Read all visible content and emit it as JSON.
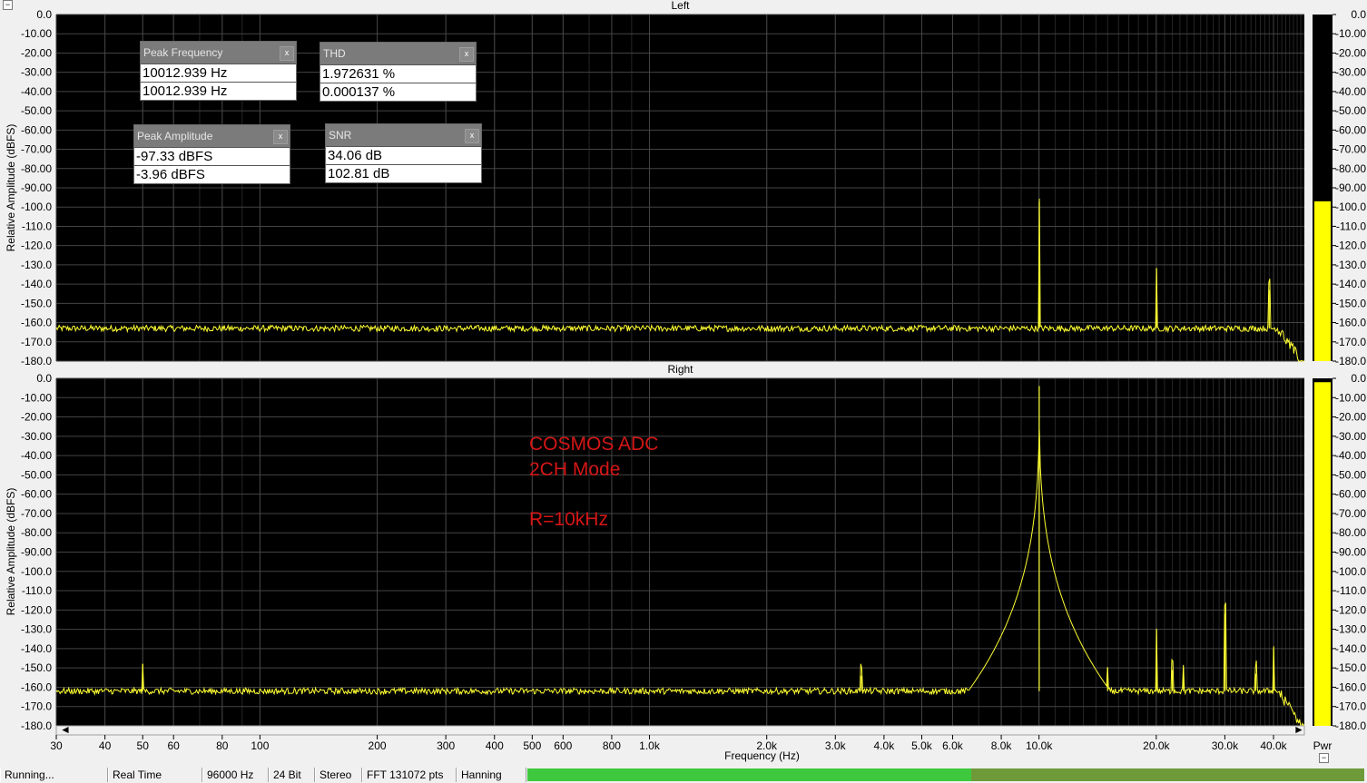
{
  "window": {
    "collapse_top": "−",
    "collapse_bottom": "−"
  },
  "overlay_text": {
    "line1": "COSMOS ADC",
    "line2": "2CH Mode",
    "line3": "R=10kHz"
  },
  "readouts": [
    {
      "title": "Peak Frequency",
      "close": "x",
      "values": [
        "10012.939 Hz",
        "10012.939 Hz"
      ]
    },
    {
      "title": "THD",
      "close": "x",
      "values": [
        "1.972631 %",
        "0.000137 %"
      ]
    },
    {
      "title": "Peak Amplitude",
      "close": "x",
      "values": [
        "-97.33 dBFS",
        "-3.96 dBFS"
      ]
    },
    {
      "title": "SNR",
      "close": "x",
      "values": [
        " 34.06 dB",
        "102.81 dB"
      ]
    }
  ],
  "status_bar": {
    "state": "Running...",
    "mode": "Real Time",
    "sample_rate": "96000 Hz",
    "bit_depth": "24 Bit",
    "channels": "Stereo",
    "fft": "FFT 131072 pts",
    "window_fn": "Hanning",
    "level_fraction": 0.53
  },
  "meter_label": "Pwr",
  "colors": {
    "plot_bg": "#000000",
    "trace": "#ffff33",
    "grid": "#3a3a3a",
    "meter": "#ffff00",
    "overlay": "#d41616",
    "status_meter": "#3ec83e"
  },
  "chart_data": [
    {
      "type": "line",
      "title": "Left",
      "xlabel": "",
      "ylabel": "Relative Amplitude (dBFS)",
      "xscale": "log",
      "xlim": [
        30,
        48000
      ],
      "ylim": [
        -180,
        0
      ],
      "x_tick_labels": [
        "30",
        "40",
        "50",
        "60",
        "80",
        "100",
        "200",
        "300",
        "400",
        "500",
        "600",
        "800",
        "1.0k",
        "2.0k",
        "3.0k",
        "4.0k",
        "5.0k",
        "6.0k",
        "8.0k",
        "10.0k",
        "20.0k",
        "30.0k",
        "40.0k"
      ],
      "y_tick_labels": [
        "0.0",
        "-10.00",
        "-20.00",
        "-30.00",
        "-40.00",
        "-50.00",
        "-60.00",
        "-70.00",
        "-80.00",
        "-90.00",
        "-100.0",
        "-110.0",
        "-120.0",
        "-130.0",
        "-140.0",
        "-150.0",
        "-160.0",
        "-170.0",
        "-180.0"
      ],
      "noise_floor_db": -163,
      "peaks": [
        {
          "x": 10013,
          "y": -97.3
        },
        {
          "x": 20026,
          "y": -132
        },
        {
          "x": 39000,
          "y": -143
        }
      ],
      "meter_level_db": -97,
      "grid": true
    },
    {
      "type": "line",
      "title": "Right",
      "xlabel": "Frequency (Hz)",
      "ylabel": "Relative Amplitude (dBFS)",
      "xscale": "log",
      "xlim": [
        30,
        48000
      ],
      "ylim": [
        -180,
        0
      ],
      "x_tick_labels": [
        "30",
        "40",
        "50",
        "60",
        "80",
        "100",
        "200",
        "300",
        "400",
        "500",
        "600",
        "800",
        "1.0k",
        "2.0k",
        "3.0k",
        "4.0k",
        "5.0k",
        "6.0k",
        "8.0k",
        "10.0k",
        "20.0k",
        "30.0k",
        "40.0k"
      ],
      "y_tick_labels": [
        "0.0",
        "-10.00",
        "-20.00",
        "-30.00",
        "-40.00",
        "-50.00",
        "-60.00",
        "-70.00",
        "-80.00",
        "-90.00",
        "-100.0",
        "-110.0",
        "-120.0",
        "-130.0",
        "-140.0",
        "-150.0",
        "-160.0",
        "-170.0",
        "-180.0"
      ],
      "noise_floor_db": -162,
      "peaks": [
        {
          "x": 50,
          "y": -148
        },
        {
          "x": 3500,
          "y": -154
        },
        {
          "x": 10013,
          "y": -4.0
        },
        {
          "x": 15000,
          "y": -150
        },
        {
          "x": 20026,
          "y": -130
        },
        {
          "x": 22000,
          "y": -151
        },
        {
          "x": 23500,
          "y": -150
        },
        {
          "x": 30040,
          "y": -122
        },
        {
          "x": 36000,
          "y": -153
        },
        {
          "x": 40000,
          "y": -140
        }
      ],
      "meter_level_db": -2,
      "grid": true
    }
  ]
}
